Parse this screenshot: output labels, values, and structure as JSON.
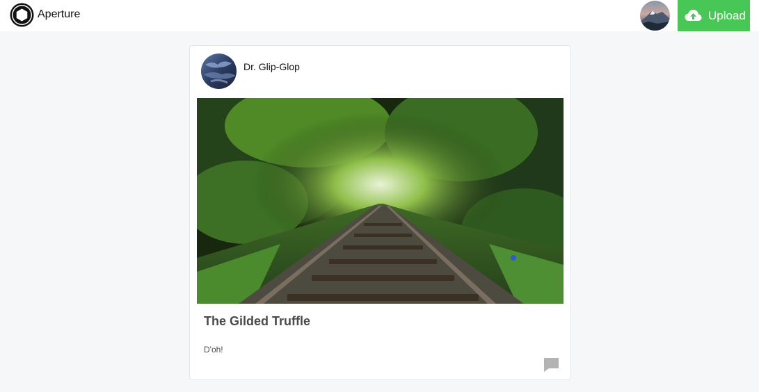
{
  "header": {
    "brand": "Aperture",
    "upload_label": "Upload",
    "upload_color": "#48c757"
  },
  "post": {
    "author": "Dr. Glip-Glop",
    "title": "The Gilded Truffle",
    "caption": "D'oh!"
  },
  "icons": {
    "logo": "aperture-logo-icon",
    "upload": "cloud-upload-icon",
    "comment": "comment-icon"
  }
}
